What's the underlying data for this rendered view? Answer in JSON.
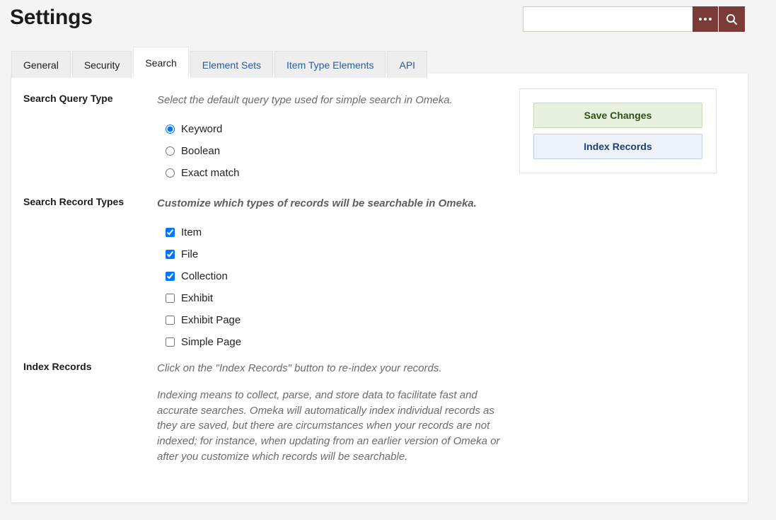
{
  "header": {
    "title": "Settings",
    "search": {
      "value": "",
      "placeholder": "",
      "advanced_icon": "ellipsis-icon",
      "submit_icon": "search-icon",
      "accent_color": "#7b3b38"
    }
  },
  "tabs": [
    {
      "label": "General",
      "active": false,
      "style": "plain"
    },
    {
      "label": "Security",
      "active": false,
      "style": "plain"
    },
    {
      "label": "Search",
      "active": true,
      "style": "active"
    },
    {
      "label": "Element Sets",
      "active": false,
      "style": "link"
    },
    {
      "label": "Item Type Elements",
      "active": false,
      "style": "link"
    },
    {
      "label": "API",
      "active": false,
      "style": "link"
    }
  ],
  "fields": {
    "query_type": {
      "label": "Search Query Type",
      "description": "Select the default query type used for simple search in Omeka.",
      "options": [
        {
          "label": "Keyword",
          "checked": true
        },
        {
          "label": "Boolean",
          "checked": false
        },
        {
          "label": "Exact match",
          "checked": false
        }
      ]
    },
    "record_types": {
      "label": "Search Record Types",
      "description": "Customize which types of records will be searchable in Omeka.",
      "options": [
        {
          "label": "Item",
          "checked": true
        },
        {
          "label": "File",
          "checked": true
        },
        {
          "label": "Collection",
          "checked": true
        },
        {
          "label": "Exhibit",
          "checked": false
        },
        {
          "label": "Exhibit Page",
          "checked": false
        },
        {
          "label": "Simple Page",
          "checked": false
        }
      ]
    },
    "index_records": {
      "label": "Index Records",
      "description": "Click on the \"Index Records\" button to re-index your records.",
      "paragraph": "Indexing means to collect, parse, and store data to facilitate fast and accurate searches. Omeka will automatically index individual records as they are saved, but there are circumstances when your records are not indexed; for instance, when updating from an earlier version of Omeka or after you customize which records will be searchable."
    }
  },
  "actions": {
    "save_label": "Save Changes",
    "index_label": "Index Records",
    "save_color": "#e8f0de",
    "index_color": "#ecf1fa"
  }
}
